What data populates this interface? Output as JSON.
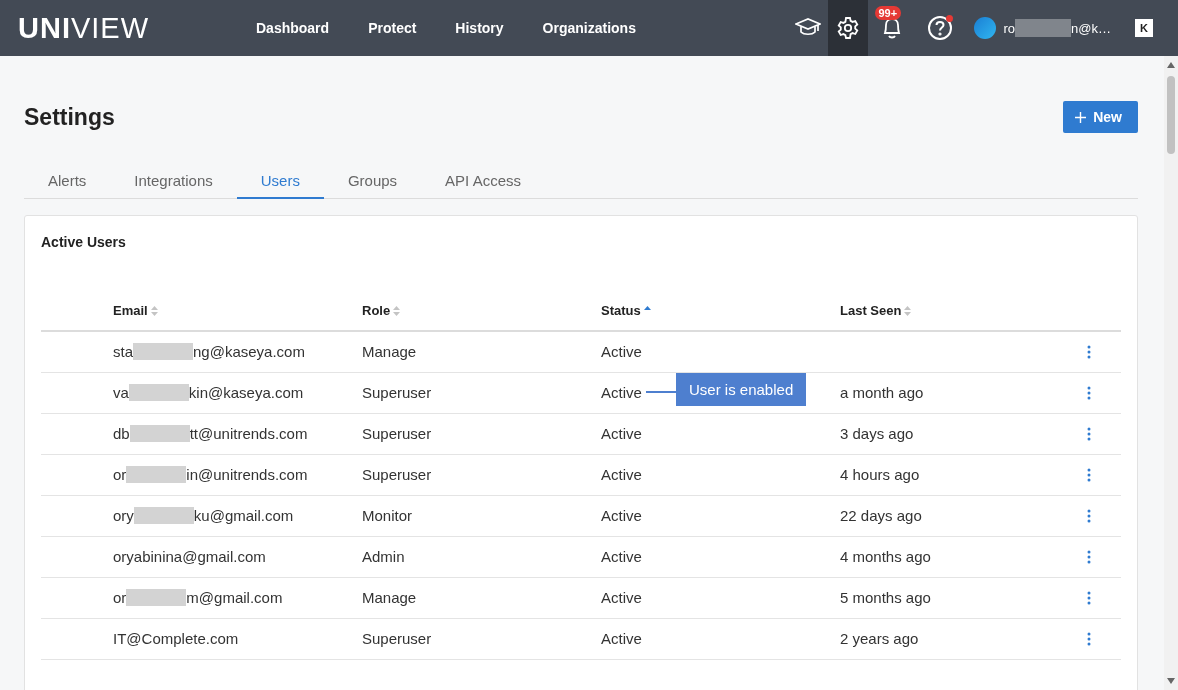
{
  "header": {
    "logo_bold": "UNI",
    "logo_light": "VIEW",
    "nav": [
      {
        "label": "Dashboard"
      },
      {
        "label": "Protect"
      },
      {
        "label": "History"
      },
      {
        "label": "Organizations"
      }
    ],
    "icons": [
      {
        "kind": "learn",
        "selected": false
      },
      {
        "kind": "settings",
        "selected": true
      },
      {
        "kind": "notifications",
        "selected": false,
        "badge": "99+"
      },
      {
        "kind": "help",
        "selected": false,
        "dot": true
      }
    ],
    "user": {
      "start": "ro",
      "end": "n@k…"
    },
    "brand": "K"
  },
  "page": {
    "title": "Settings",
    "new_button": "New"
  },
  "tabs": [
    {
      "label": "Alerts",
      "selected": false
    },
    {
      "label": "Integrations",
      "selected": false
    },
    {
      "label": "Users",
      "selected": true
    },
    {
      "label": "Groups",
      "selected": false
    },
    {
      "label": "API Access",
      "selected": false
    }
  ],
  "card": {
    "title": "Active Users",
    "columns": [
      {
        "label": "Email",
        "sorted": false
      },
      {
        "label": "Role",
        "sorted": false
      },
      {
        "label": "Status",
        "sorted": true
      },
      {
        "label": "Last Seen",
        "sorted": false
      }
    ],
    "rows": [
      {
        "email_start": "sta",
        "email_end": "ng@kaseya.com",
        "role": "Manage",
        "status": "Active"
      },
      {
        "email_start": "va",
        "email_end": "kin@kaseya.com",
        "role": "Superuser",
        "status": "Active",
        "last_seen": "a month ago",
        "tooltip": "User is enabled"
      },
      {
        "email_start": "db",
        "email_end": "tt@unitrends.com",
        "role": "Superuser",
        "status": "Active",
        "last_seen": "3 days ago"
      },
      {
        "email_start": "or",
        "email_end": "in@unitrends.com",
        "role": "Superuser",
        "status": "Active",
        "last_seen": "4 hours ago"
      },
      {
        "email_start": "ory",
        "email_end": "ku@gmail.com",
        "role": "Monitor",
        "status": "Active",
        "last_seen": "22 days ago"
      },
      {
        "email_start": "oryabinina@gmail.com",
        "role": "Admin",
        "status": "Active",
        "last_seen": "4 months ago"
      },
      {
        "email_start": "or",
        "email_end": "m@gmail.com",
        "role": "Manage",
        "status": "Active",
        "last_seen": "5 months ago"
      },
      {
        "email_start": "IT@Complete.com",
        "role": "Superuser",
        "status": "Active",
        "last_seen": "2 years ago"
      }
    ]
  }
}
